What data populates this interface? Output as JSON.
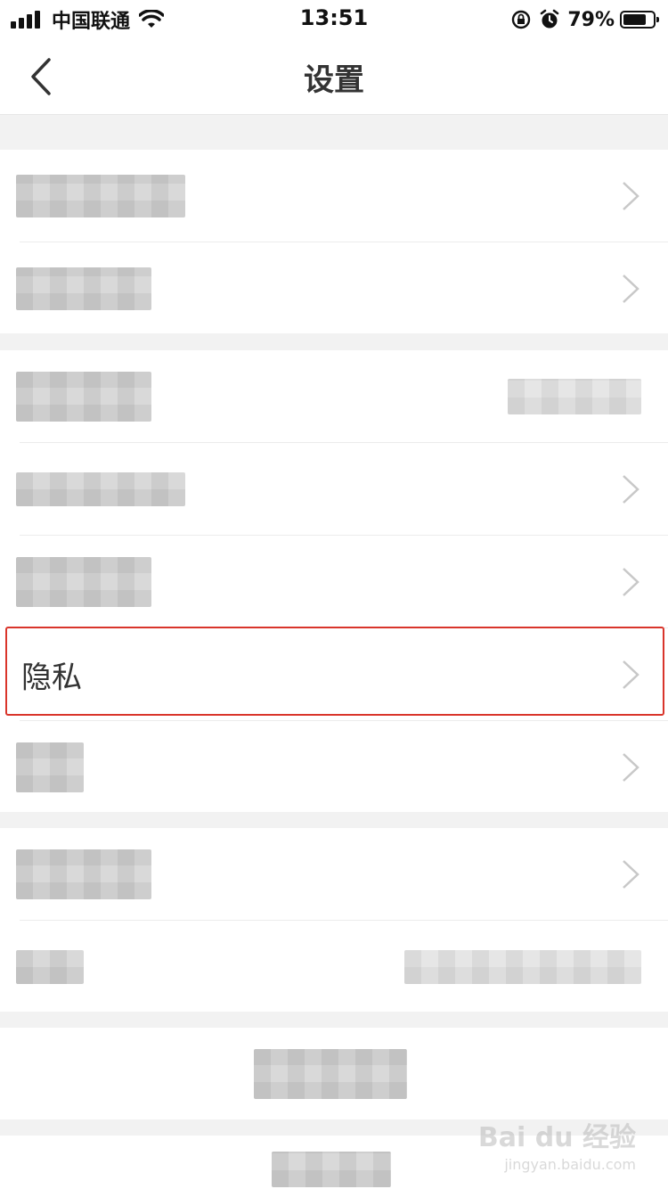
{
  "status_bar": {
    "carrier": "中国联通",
    "time": "13:51",
    "battery_percent": "79%",
    "battery_level": 0.79,
    "icons": [
      "signal-icon",
      "wifi-icon",
      "rotation-lock-icon",
      "alarm-icon",
      "battery-icon"
    ]
  },
  "nav": {
    "title": "设置",
    "back_icon": "chevron-left-icon"
  },
  "settings": {
    "privacy_label": "隐私"
  },
  "watermark": {
    "brand": "Bai du 经验",
    "url": "jingyan.baidu.com"
  },
  "colors": {
    "highlight": "#d9352b",
    "background": "#f2f2f2",
    "row_bg": "#ffffff"
  }
}
